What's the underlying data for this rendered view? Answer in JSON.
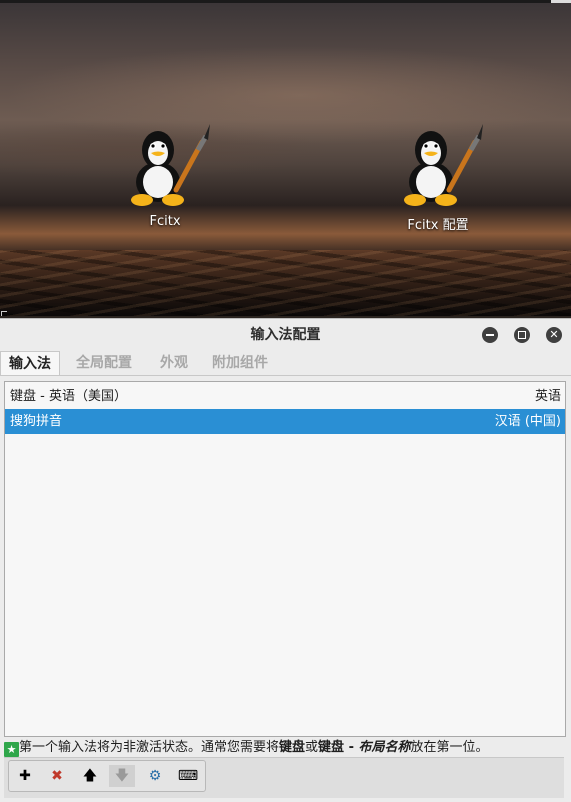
{
  "desktop": {
    "icons": [
      {
        "label": "Fcitx",
        "icon": "fcitx-penguin-icon"
      },
      {
        "label": "Fcitx 配置",
        "icon": "fcitx-config-penguin-icon"
      }
    ]
  },
  "window": {
    "title": "输入法配置",
    "controls": [
      "minimize-icon",
      "maximize-icon",
      "close-icon"
    ],
    "close_glyph": "✕"
  },
  "tabs": [
    {
      "label": "输入法",
      "active": true
    },
    {
      "label": "全局配置",
      "active": false
    },
    {
      "label": "外观",
      "active": false
    },
    {
      "label": "附加组件",
      "active": false
    }
  ],
  "input_methods": [
    {
      "name": "键盘 - 英语（美国）",
      "language": "英语",
      "selected": false
    },
    {
      "name": "搜狗拼音",
      "language": "汉语 (中国)",
      "selected": true
    }
  ],
  "hint": {
    "icon": "info-star-icon",
    "star_glyph": "★",
    "part1": "第一个输入法将为非激活状态。通常您需要将",
    "bold1": "键盘",
    "part2": "或",
    "bold2": "键盘 - ",
    "bold_italic": "布局名称",
    "part3": "放在第一位。"
  },
  "toolbar": {
    "buttons": [
      {
        "name": "add",
        "glyph": "✚",
        "icon": "plus-icon",
        "enabled": true,
        "color": "#1e1e1e"
      },
      {
        "name": "remove",
        "glyph": "✖",
        "icon": "remove-icon",
        "enabled": true,
        "color": "#c0392b"
      },
      {
        "name": "move-up",
        "glyph": "🡅",
        "icon": "arrow-up-icon",
        "enabled": true,
        "color": "#333333"
      },
      {
        "name": "move-down",
        "glyph": "🡇",
        "icon": "arrow-down-icon",
        "enabled": false,
        "color": "#9a9a9a"
      },
      {
        "name": "configure",
        "glyph": "⚙",
        "icon": "configure-icon",
        "enabled": true,
        "color": "#2a6fa8"
      },
      {
        "name": "keyboard-layout",
        "glyph": "⌨",
        "icon": "keyboard-icon",
        "enabled": true,
        "color": "#222222"
      }
    ]
  },
  "colors": {
    "selection": "#2a8fd4",
    "window_bg": "#ececec",
    "hint_star": "#2fa64a"
  }
}
